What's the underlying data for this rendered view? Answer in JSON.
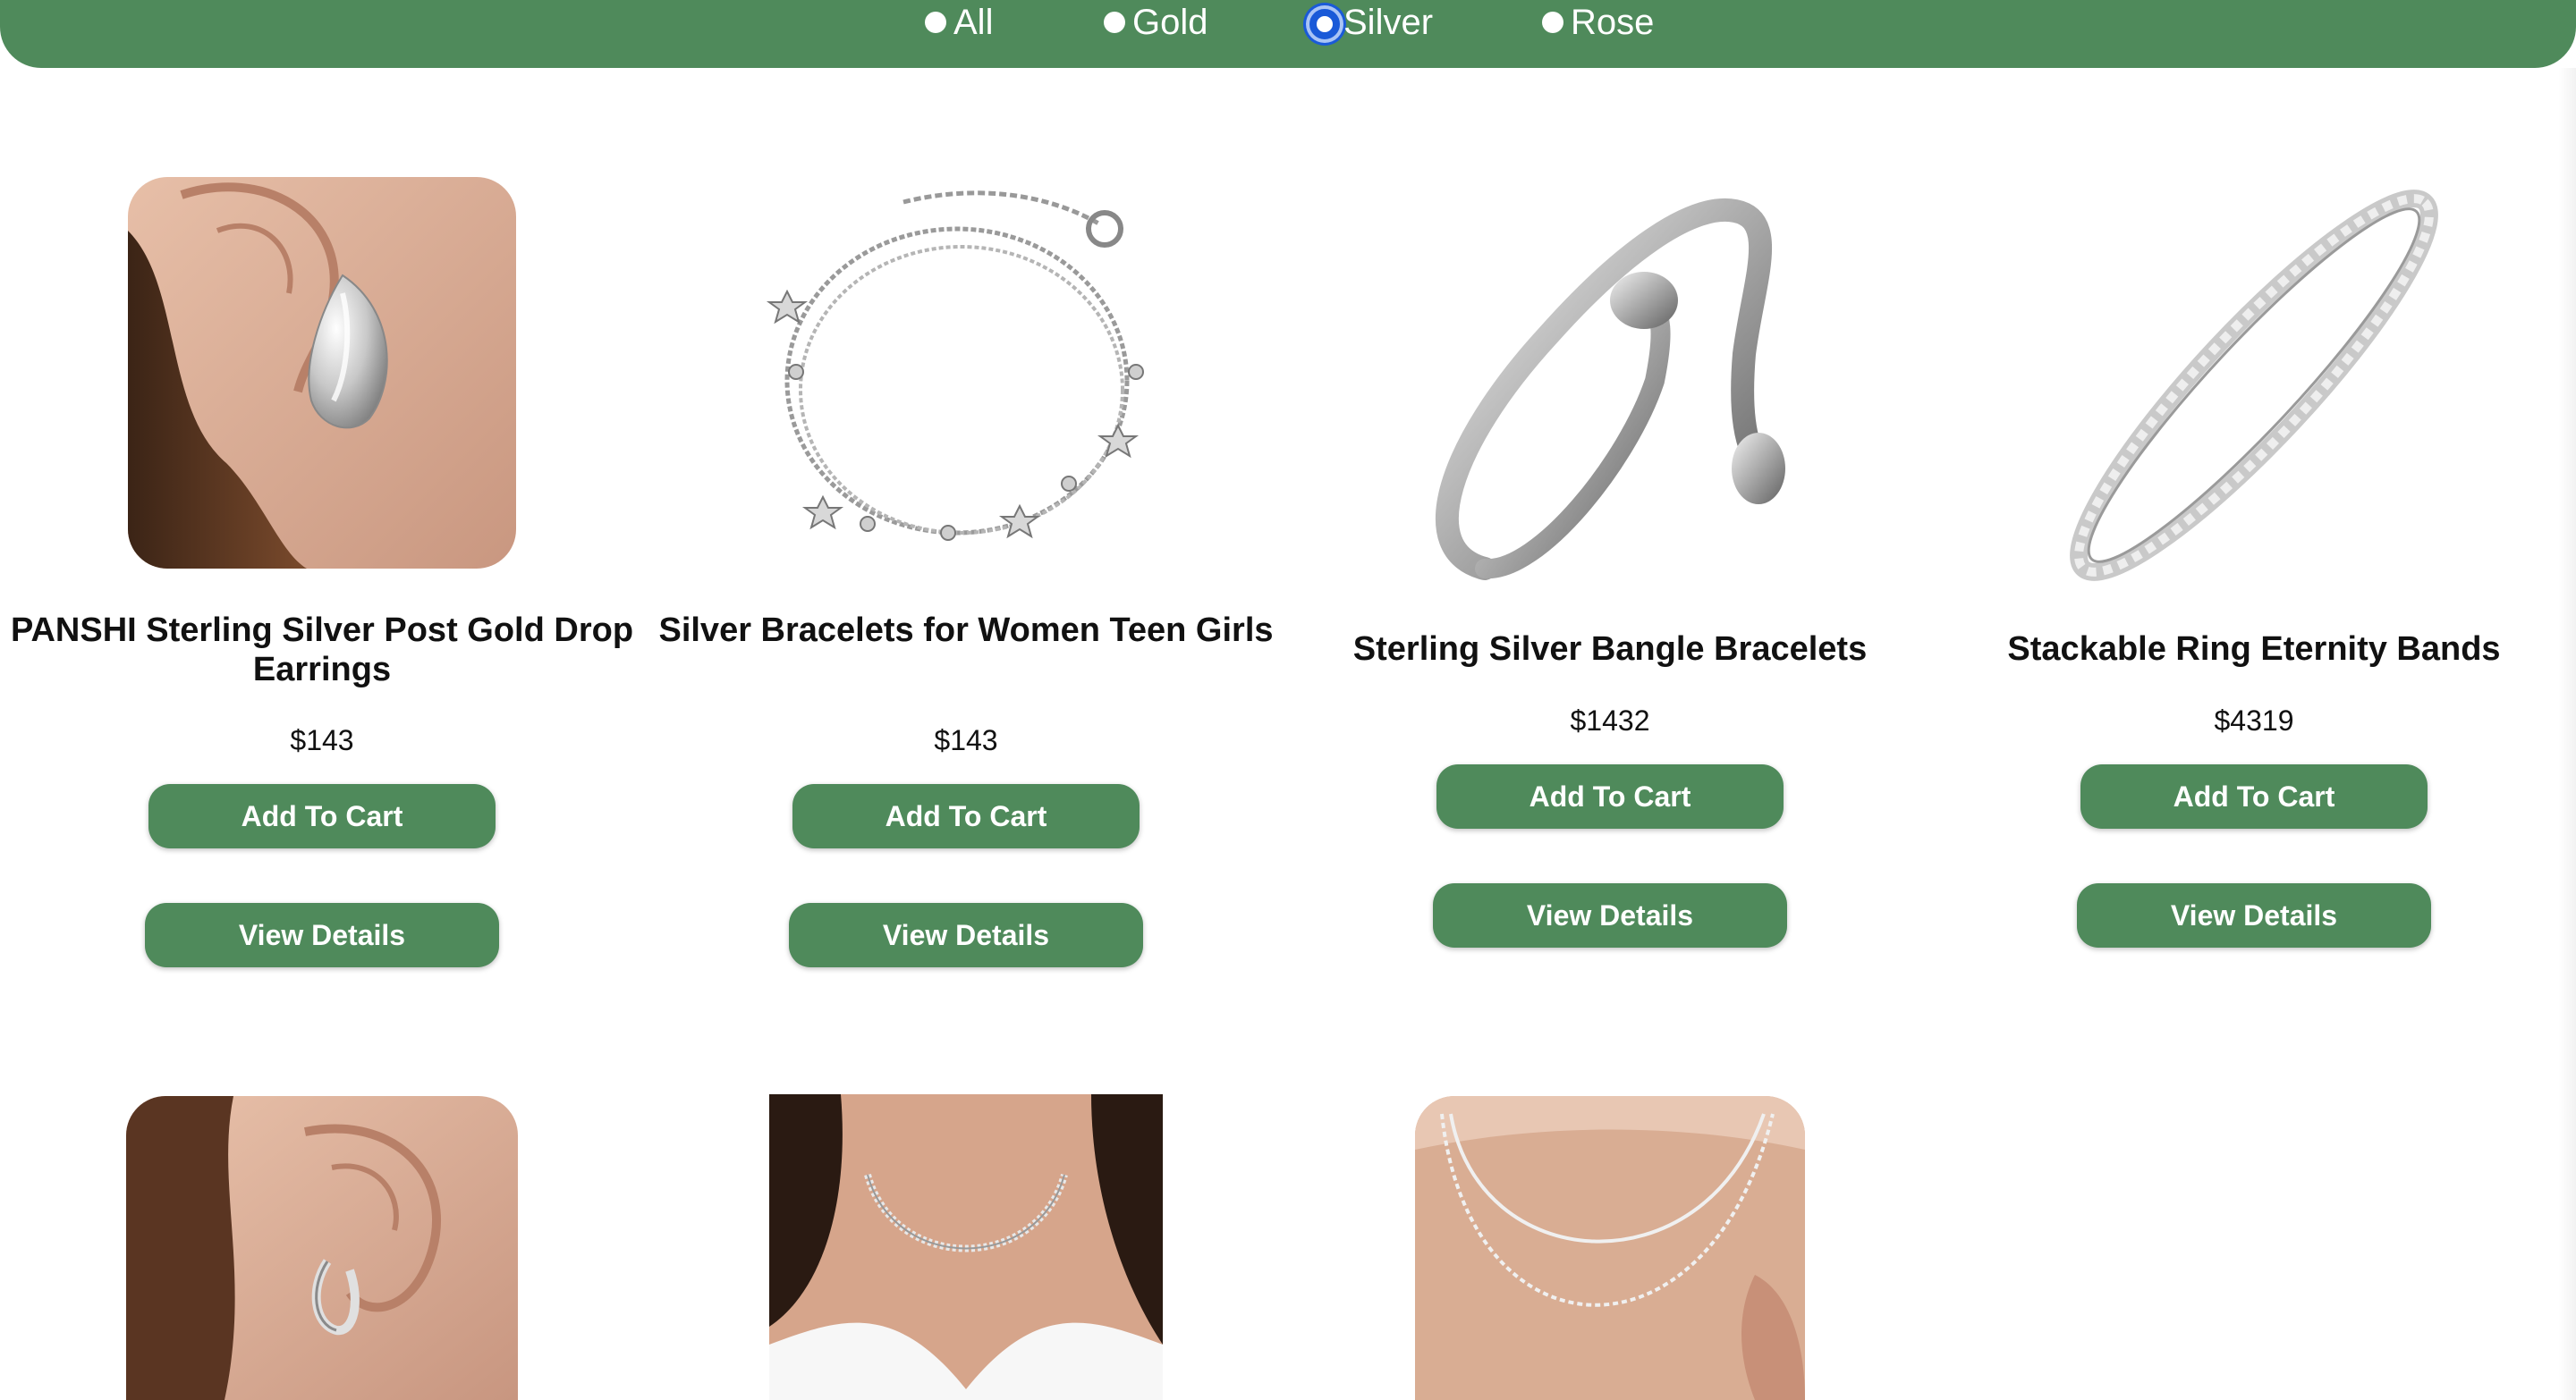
{
  "filters": {
    "options": [
      "All",
      "Gold",
      "Silver",
      "Rose"
    ],
    "selected": "Silver"
  },
  "products": [
    {
      "title": "PANSHI Sterling Silver Post Gold Drop Earrings",
      "price": "$143",
      "add_label": "Add To Cart",
      "details_label": "View Details"
    },
    {
      "title": "Silver Bracelets for Women Teen Girls",
      "price": "$143",
      "add_label": "Add To Cart",
      "details_label": "View Details"
    },
    {
      "title": "Sterling Silver Bangle Bracelets",
      "price": "$1432",
      "add_label": "Add To Cart",
      "details_label": "View Details"
    },
    {
      "title": "Stackable Ring Eternity Bands",
      "price": "$4319",
      "add_label": "Add To Cart",
      "details_label": "View Details"
    }
  ],
  "colors": {
    "brand_green": "#4f8a5b",
    "focus_ring": "#1a5ad8"
  }
}
